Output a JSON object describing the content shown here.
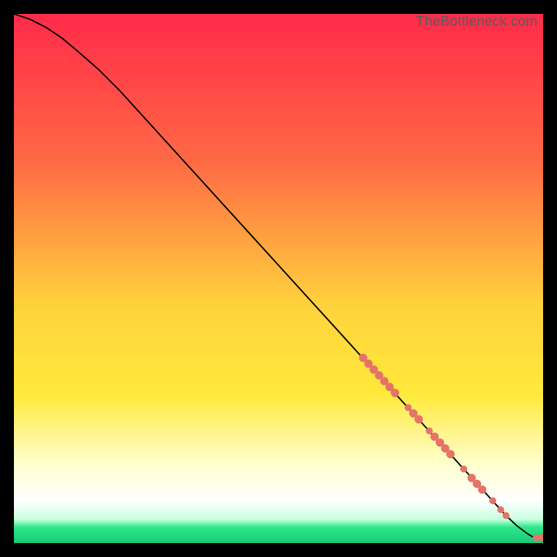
{
  "attribution": "TheBottleneck.com",
  "colors": {
    "curve": "#000000",
    "marker": "#e57368",
    "top_red": "#ff2a4a",
    "mid_orange": "#ff8a3c",
    "mid_yellow": "#ffe43c",
    "pale_yellow": "#ffffce",
    "white": "#ffffff",
    "green": "#2fe989"
  },
  "chart_data": {
    "type": "line",
    "xlabel": "",
    "ylabel": "",
    "xlim": [
      0,
      100
    ],
    "ylim": [
      0,
      100
    ],
    "title": "",
    "series": [
      {
        "name": "curve",
        "x": [
          0,
          3,
          6,
          9,
          12,
          16,
          20,
          25,
          30,
          35,
          40,
          45,
          50,
          55,
          60,
          65,
          70,
          75,
          80,
          85,
          90,
          93,
          95,
          97,
          98,
          99,
          100
        ],
        "y": [
          100,
          99,
          97.5,
          95.5,
          93,
          89.5,
          85.5,
          80,
          74.5,
          69,
          63.5,
          58,
          52.5,
          47,
          41.5,
          36,
          30.5,
          25,
          19.5,
          14,
          8.5,
          5.2,
          3.3,
          1.8,
          1.2,
          1.0,
          1.0
        ]
      }
    ],
    "markers": {
      "name": "highlight-points",
      "color": "#e57368",
      "points": [
        {
          "x": 66,
          "y": 35.0,
          "r": 6
        },
        {
          "x": 67,
          "y": 33.9,
          "r": 6
        },
        {
          "x": 68,
          "y": 32.8,
          "r": 6
        },
        {
          "x": 69,
          "y": 31.7,
          "r": 6
        },
        {
          "x": 70,
          "y": 30.6,
          "r": 6
        },
        {
          "x": 71,
          "y": 29.5,
          "r": 6
        },
        {
          "x": 72,
          "y": 28.4,
          "r": 6
        },
        {
          "x": 74.5,
          "y": 25.6,
          "r": 5
        },
        {
          "x": 75.5,
          "y": 24.5,
          "r": 6
        },
        {
          "x": 76.5,
          "y": 23.4,
          "r": 6
        },
        {
          "x": 78.5,
          "y": 21.2,
          "r": 5
        },
        {
          "x": 79.5,
          "y": 20.1,
          "r": 6
        },
        {
          "x": 80.5,
          "y": 19.0,
          "r": 6
        },
        {
          "x": 81.5,
          "y": 17.9,
          "r": 6
        },
        {
          "x": 82.5,
          "y": 16.8,
          "r": 6
        },
        {
          "x": 85.0,
          "y": 14.0,
          "r": 5
        },
        {
          "x": 86.5,
          "y": 12.3,
          "r": 6
        },
        {
          "x": 87.5,
          "y": 11.2,
          "r": 6
        },
        {
          "x": 88.5,
          "y": 10.1,
          "r": 6
        },
        {
          "x": 90.5,
          "y": 8.0,
          "r": 5
        },
        {
          "x": 92.0,
          "y": 6.3,
          "r": 5
        },
        {
          "x": 93.0,
          "y": 5.2,
          "r": 5
        },
        {
          "x": 98.7,
          "y": 1.0,
          "r": 5
        },
        {
          "x": 100.0,
          "y": 1.0,
          "r": 6
        }
      ]
    }
  }
}
